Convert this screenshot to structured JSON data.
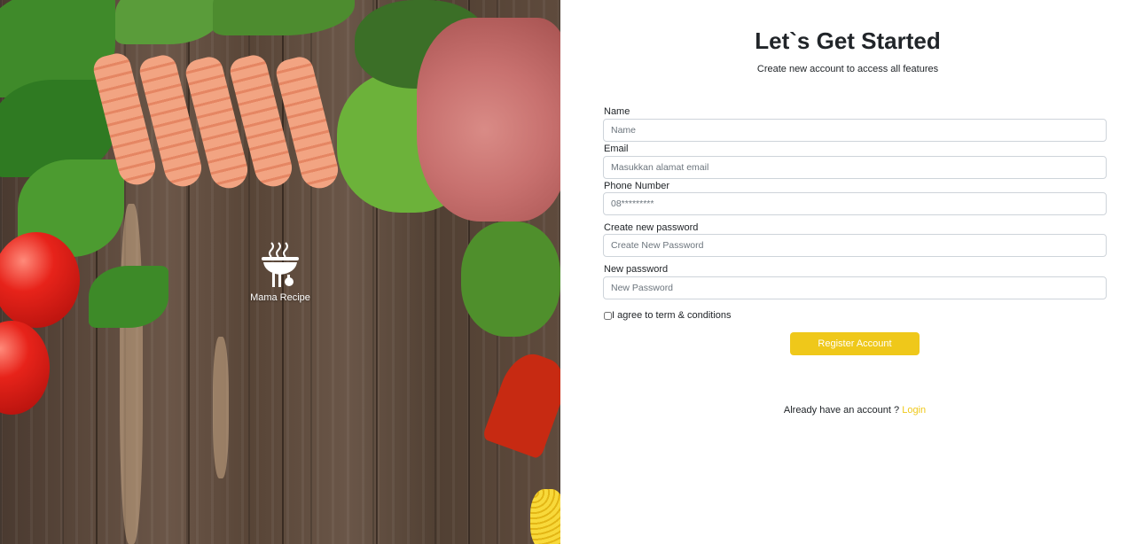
{
  "brand": {
    "name": "Mama Recipe",
    "logo_icon": "grill-chef-icon"
  },
  "form": {
    "title": "Let`s Get Started",
    "subtitle": "Create new account to access all features",
    "fields": [
      {
        "label": "Name",
        "placeholder": "Name",
        "value": ""
      },
      {
        "label": "Email",
        "placeholder": "Masukkan alamat email",
        "value": ""
      },
      {
        "label": "Phone Number",
        "placeholder": "08*********",
        "value": ""
      },
      {
        "label": "Create new password",
        "placeholder": "Create New Password",
        "value": ""
      },
      {
        "label": "New password",
        "placeholder": "New Password",
        "value": ""
      }
    ],
    "agree_label": "I agree to term & conditions",
    "submit_label": "Register Account",
    "login_prompt": "Already have an account ?",
    "login_link": "Login"
  },
  "colors": {
    "accent": "#EFC81A",
    "text": "#212529",
    "input_border": "#CED4DA",
    "placeholder": "#6C757D"
  }
}
